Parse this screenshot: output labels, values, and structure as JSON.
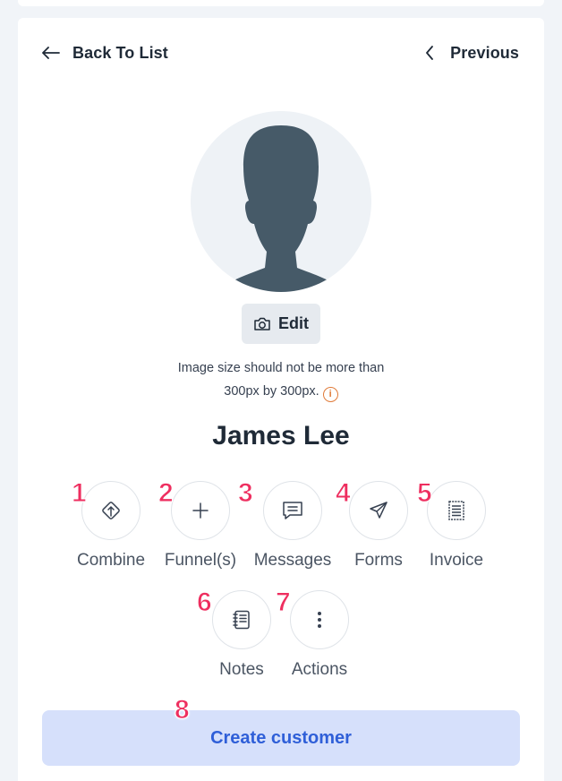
{
  "nav": {
    "back_label": "Back To List",
    "previous_label": "Previous"
  },
  "profile": {
    "edit_label": "Edit",
    "image_hint_line1": "Image size should not be more than",
    "image_hint_line2": "300px by 300px.",
    "info_icon_glyph": "i",
    "name": "James Lee"
  },
  "actions": [
    {
      "label": "Combine",
      "icon": "combine-icon",
      "badge": "1"
    },
    {
      "label": "Funnel(s)",
      "icon": "plus-icon",
      "badge": "2"
    },
    {
      "label": "Messages",
      "icon": "message-icon",
      "badge": "3"
    },
    {
      "label": "Forms",
      "icon": "send-icon",
      "badge": "4"
    },
    {
      "label": "Invoice",
      "icon": "invoice-icon",
      "badge": "5"
    },
    {
      "label": "Notes",
      "icon": "notes-icon",
      "badge": "6"
    },
    {
      "label": "Actions",
      "icon": "more-vertical-icon",
      "badge": "7"
    }
  ],
  "create": {
    "label": "Create customer",
    "badge": "8"
  },
  "colors": {
    "background": "#f1f4f8",
    "primary_text": "#1f2a37",
    "button_bg": "#d6e0fb",
    "button_text": "#2f5fd8",
    "badge": "#ee2e5f",
    "info": "#e07b39"
  }
}
